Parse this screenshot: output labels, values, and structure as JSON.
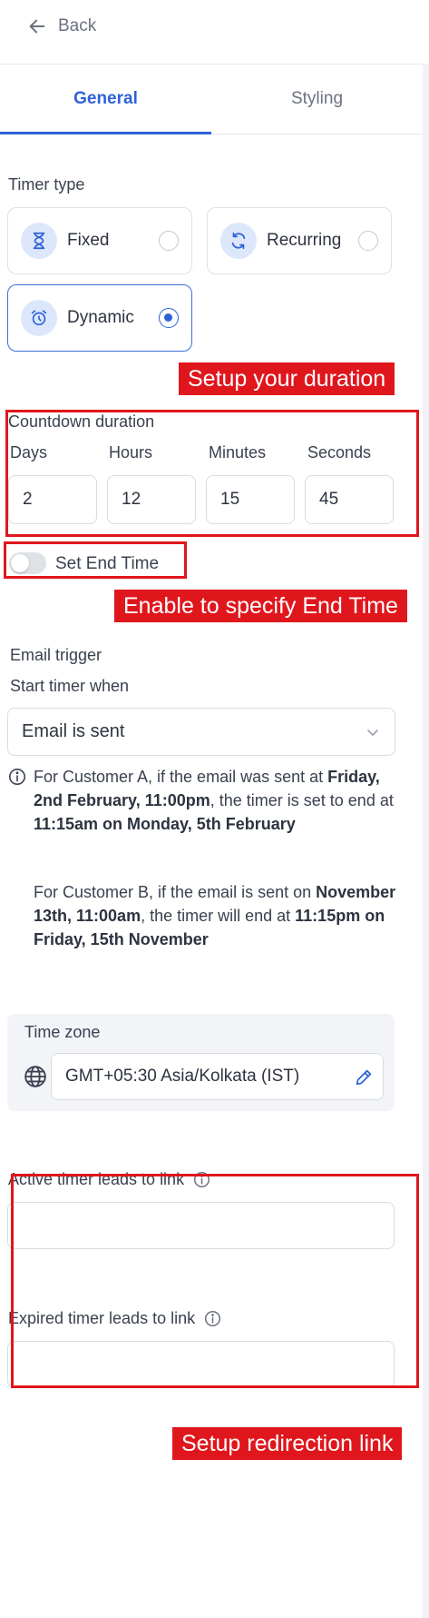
{
  "header": {
    "back_label": "Back"
  },
  "tabs": [
    {
      "label": "General"
    },
    {
      "label": "Styling"
    }
  ],
  "timer_type": {
    "label": "Timer type",
    "options": [
      {
        "label": "Fixed",
        "icon": "hourglass-icon"
      },
      {
        "label": "Recurring",
        "icon": "recurring-icon"
      },
      {
        "label": "Dynamic",
        "icon": "alarm-clock-icon"
      }
    ],
    "selected": "Dynamic"
  },
  "callouts": {
    "duration": "Setup  your duration",
    "end_time": "Enable to specify End Time",
    "redirection": "Setup redirection link"
  },
  "countdown": {
    "label": "Countdown duration",
    "units": [
      {
        "label": "Days",
        "value": "2"
      },
      {
        "label": "Hours",
        "value": "12"
      },
      {
        "label": "Minutes",
        "value": "15"
      },
      {
        "label": "Seconds",
        "value": "45"
      }
    ]
  },
  "end_time_toggle": {
    "label": "Set End Time",
    "enabled": false
  },
  "email_trigger": {
    "label": "Email trigger",
    "start_label": "Start timer when",
    "selected": "Email is sent"
  },
  "info": {
    "customer_a": {
      "t1": "For Customer A, if the email was sent at ",
      "b1": "Friday, 2nd February, 11:00pm",
      "t2": ", the timer is set to end at ",
      "b2": "11:15am on Monday, 5th February"
    },
    "customer_b": {
      "t1": "For Customer B, if the email is sent on ",
      "b1": "November 13th, 11:00am",
      "t2": ", the timer will end at ",
      "b2": "11:15pm on Friday, 15th November"
    }
  },
  "timezone": {
    "label": "Time zone",
    "value": "GMT+05:30 Asia/Kolkata (IST)"
  },
  "links": {
    "active_label": "Active timer leads to link",
    "active_value": "",
    "expired_label": "Expired timer leads to link",
    "expired_value": ""
  },
  "colors": {
    "accent": "#2e62d8",
    "annotation_red": "#e0161d"
  }
}
